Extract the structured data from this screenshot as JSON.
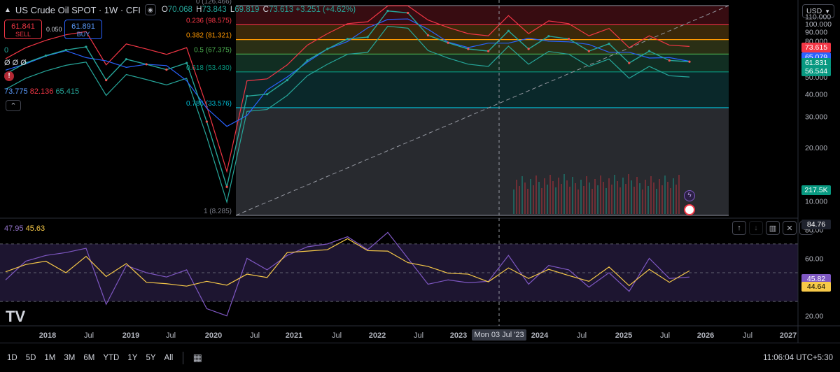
{
  "header": {
    "title": "US Crude Oil SPOT · 1W · CFI",
    "ohlc": [
      {
        "k": "O",
        "v": "70.068"
      },
      {
        "k": "H",
        "v": "73.843"
      },
      {
        "k": "L",
        "v": "69.819"
      },
      {
        "k": "C",
        "v": "73.613"
      }
    ],
    "change": "+3.251 (+4.62%)",
    "currency": "USD",
    "colors": {
      "up": "#26a69a",
      "down": "#ef5350"
    }
  },
  "trade": {
    "sell_price": "61.841",
    "sell_label": "SELL",
    "spread": "0.050",
    "buy_price": "61.891",
    "buy_label": "BUY"
  },
  "indicators": {
    "line1": "0",
    "line2": "Ø Ø Ø",
    "bb_values": [
      "73.775",
      "82.136",
      "65.415"
    ],
    "rsi_values": [
      "47.95",
      "45.63"
    ]
  },
  "price_axis": {
    "ticks": [
      "110.000",
      "100.000",
      "90.000",
      "80.000",
      "70.000",
      "60.000",
      "50.000",
      "40.000",
      "30.000",
      "20.000",
      "10.000"
    ],
    "tags": [
      {
        "label": "73.615",
        "value": 73.615,
        "color": "#f23645"
      },
      {
        "label": "65.079",
        "value": 65.079,
        "color": "#2962ff"
      },
      {
        "label": "61.831",
        "value": 61.831,
        "color": "#089981"
      },
      {
        "label": "56.544",
        "value": 56.544,
        "color": "#089981"
      }
    ],
    "volume_tag": "217.5K"
  },
  "rsi_axis": {
    "ticks": [
      "80.00",
      "60.00",
      "40.00",
      "20.00"
    ],
    "top_tag": "84.76",
    "tags": [
      {
        "label": "45.82",
        "value": 45.82,
        "color": "#7e57c2"
      },
      {
        "label": "44.64",
        "value": 44.64,
        "color": "#f7c948"
      }
    ]
  },
  "fib": {
    "levels": [
      {
        "ratio": "0",
        "label": "0 (126.466)",
        "price": 126.466,
        "color": "#787b86",
        "fill": "#3a0d12"
      },
      {
        "ratio": "0.236",
        "label": "0.236 (98.575)",
        "price": 98.575,
        "color": "#f23645",
        "fill": "#3d2a0b"
      },
      {
        "ratio": "0.382",
        "label": "0.382 (81.321)",
        "price": 81.321,
        "color": "#ff9800",
        "fill": "#2c3216"
      },
      {
        "ratio": "0.5",
        "label": "0.5 (67.375)",
        "price": 67.375,
        "color": "#4caf50",
        "fill": "#123024"
      },
      {
        "ratio": "0.618",
        "label": "0.618 (53.430)",
        "price": 53.43,
        "color": "#089981",
        "fill": "#0b2a2c"
      },
      {
        "ratio": "0.786",
        "label": "0.786 (33.576)",
        "price": 33.576,
        "color": "#00bcd4",
        "fill": "#2a2c31"
      },
      {
        "ratio": "1",
        "label": "1 (8.285)",
        "price": 8.285,
        "color": "#787b86",
        "fill": "none"
      }
    ]
  },
  "time_axis": {
    "labels": [
      "2018",
      "Jul",
      "2019",
      "Jul",
      "2020",
      "Jul",
      "2021",
      "Jul",
      "2022",
      "Jul",
      "2023",
      "2024",
      "Jul",
      "2025",
      "Jul",
      "2026",
      "Jul",
      "2027"
    ],
    "crosshair_label": "Mon 03 Jul '23"
  },
  "bottom": {
    "timeframes": [
      "1D",
      "5D",
      "1M",
      "3M",
      "6M",
      "YTD",
      "1Y",
      "5Y",
      "All"
    ],
    "clock": "11:06:04 UTC+5:30"
  },
  "chart_data": {
    "type": "line",
    "title": "US Crude Oil SPOT · 1W · CFI",
    "xlabel": "",
    "ylabel": "",
    "ylim": [
      8,
      126
    ],
    "x": [
      "2017-10",
      "2018-01",
      "2018-04",
      "2018-07",
      "2018-10",
      "2018-12",
      "2019-04",
      "2019-07",
      "2019-10",
      "2020-01",
      "2020-03",
      "2020-04",
      "2020-06",
      "2020-09",
      "2020-12",
      "2021-03",
      "2021-06",
      "2021-10",
      "2022-01",
      "2022-03",
      "2022-06",
      "2022-09",
      "2022-12",
      "2023-03",
      "2023-06",
      "2023-09",
      "2023-12",
      "2024-04",
      "2024-07",
      "2024-09",
      "2025-01",
      "2025-04",
      "2025-06",
      "2025-09",
      "2025-10"
    ],
    "series": [
      {
        "name": "",
        "values": [
          52,
          60,
          66,
          71,
          74,
          48,
          63,
          59,
          55,
          60,
          28,
          12,
          39,
          40,
          48,
          62,
          72,
          82,
          84,
          118,
          115,
          86,
          78,
          72,
          70,
          91,
          72,
          85,
          82,
          70,
          77,
          60,
          70,
          62,
          61
        ]
      }
    ],
    "rsi": {
      "name": "RSI",
      "ylim": [
        15,
        85
      ],
      "values": [
        45,
        58,
        62,
        64,
        67,
        28,
        55,
        50,
        47,
        52,
        25,
        20,
        60,
        52,
        62,
        68,
        70,
        75,
        66,
        78,
        60,
        42,
        45,
        43,
        44,
        62,
        42,
        55,
        52,
        40,
        50,
        37,
        60,
        46,
        47
      ]
    }
  }
}
